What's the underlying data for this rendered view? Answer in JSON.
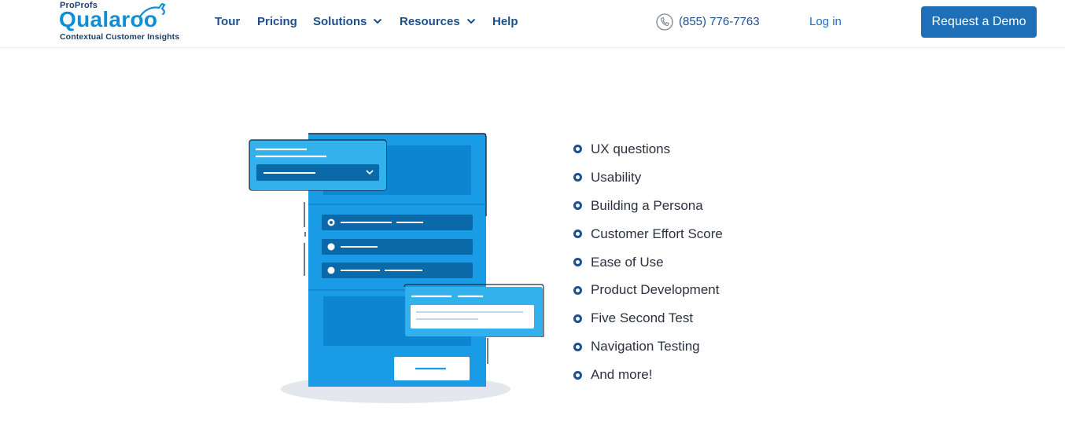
{
  "header": {
    "logo": {
      "brand_parent": "ProProfs",
      "brand_name": "Qualaroo",
      "tagline": "Contextual Customer Insights"
    },
    "nav": [
      {
        "label": "Tour",
        "has_dropdown": false
      },
      {
        "label": "Pricing",
        "has_dropdown": false
      },
      {
        "label": "Solutions",
        "has_dropdown": true
      },
      {
        "label": "Resources",
        "has_dropdown": true
      },
      {
        "label": "Help",
        "has_dropdown": false
      }
    ],
    "phone": {
      "icon": "phone-icon",
      "number": "(855) 776-7763"
    },
    "login_label": "Log in",
    "cta_label": "Request a Demo"
  },
  "features": {
    "items": [
      "UX questions",
      "Usability",
      "Building a Persona",
      "Customer Effort Score",
      "Ease of Use",
      "Product Development",
      "Five Second Test",
      "Navigation Testing",
      "And more!"
    ]
  },
  "colors": {
    "brand_blue": "#0d8fd8",
    "nav_text": "#1d4f8c",
    "cta_background": "#1d6fb8",
    "illustration_blue": "#1a9be6",
    "illustration_dark": "#0a69a8"
  }
}
